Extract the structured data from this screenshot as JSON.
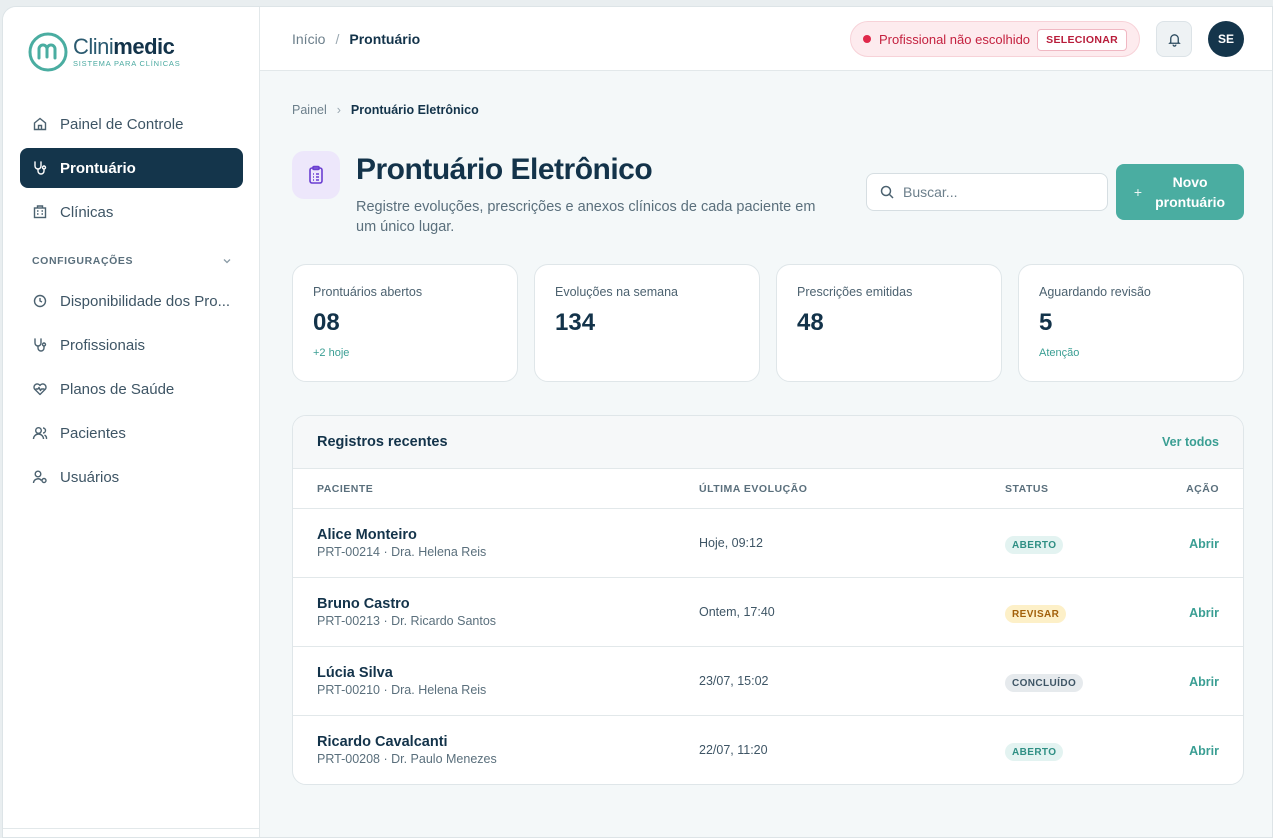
{
  "logo": {
    "name_light": "Clini",
    "name_bold": "medic",
    "tagline": "SISTEMA PARA CLÍNICAS"
  },
  "sidebar": {
    "items": [
      {
        "label": "Painel de Controle",
        "icon": "home-icon"
      },
      {
        "label": "Prontuário",
        "icon": "stethoscope-icon",
        "active": true
      },
      {
        "label": "Clínicas",
        "icon": "building-icon"
      }
    ],
    "section_label": "CONFIGURAÇÕES",
    "config_items": [
      {
        "label": "Disponibilidade dos Pro...",
        "icon": "clock-icon"
      },
      {
        "label": "Profissionais",
        "icon": "stethoscope-icon"
      },
      {
        "label": "Planos de Saúde",
        "icon": "heart-pulse-icon"
      },
      {
        "label": "Pacientes",
        "icon": "users-icon"
      },
      {
        "label": "Usuários",
        "icon": "user-cog-icon"
      }
    ]
  },
  "topbar": {
    "breadcrumb": {
      "home": "Início",
      "sep": "/",
      "current": "Prontuário"
    },
    "professional": {
      "status": "Profissional não escolhido",
      "action": "SELECIONAR"
    },
    "avatar_initials": "SE"
  },
  "page": {
    "breadcrumb": {
      "parent": "Painel",
      "sep": "›",
      "current": "Prontuário Eletrônico"
    },
    "title": "Prontuário Eletrônico",
    "description": "Registre evoluções, prescrições e anexos clínicos de cada paciente em um único lugar.",
    "search_placeholder": "Buscar...",
    "new_button": "Novo prontuário",
    "new_button_icon": "+"
  },
  "stats": [
    {
      "label": "Prontuários abertos",
      "value": "08",
      "sub": "+2 hoje"
    },
    {
      "label": "Evoluções na semana",
      "value": "134",
      "sub": ""
    },
    {
      "label": "Prescrições emitidas",
      "value": "48",
      "sub": ""
    },
    {
      "label": "Aguardando revisão",
      "value": "5",
      "sub": "Atenção"
    }
  ],
  "records": {
    "title": "Registros recentes",
    "view_all": "Ver todos",
    "columns": [
      "PACIENTE",
      "ÚLTIMA EVOLUÇÃO",
      "STATUS",
      "AÇÃO"
    ],
    "rows": [
      {
        "name": "Alice Monteiro",
        "meta": "PRT-00214 · Dra. Helena Reis",
        "last": "Hoje, 09:12",
        "status": "ABERTO",
        "status_kind": "aberto",
        "action": "Abrir"
      },
      {
        "name": "Bruno Castro",
        "meta": "PRT-00213 · Dr. Ricardo Santos",
        "last": "Ontem, 17:40",
        "status": "REVISAR",
        "status_kind": "revisar",
        "action": "Abrir"
      },
      {
        "name": "Lúcia Silva",
        "meta": "PRT-00210 · Dra. Helena Reis",
        "last": "23/07, 15:02",
        "status": "CONCLUÍDO",
        "status_kind": "concluido",
        "action": "Abrir"
      },
      {
        "name": "Ricardo Cavalcanti",
        "meta": "PRT-00208 · Dr. Paulo Menezes",
        "last": "22/07, 11:20",
        "status": "ABERTO",
        "status_kind": "aberto",
        "action": "Abrir"
      }
    ]
  },
  "colors": {
    "primary": "#14354b",
    "accent": "#4aada1",
    "danger": "#e0284a",
    "warning": "#fdf0c8"
  }
}
